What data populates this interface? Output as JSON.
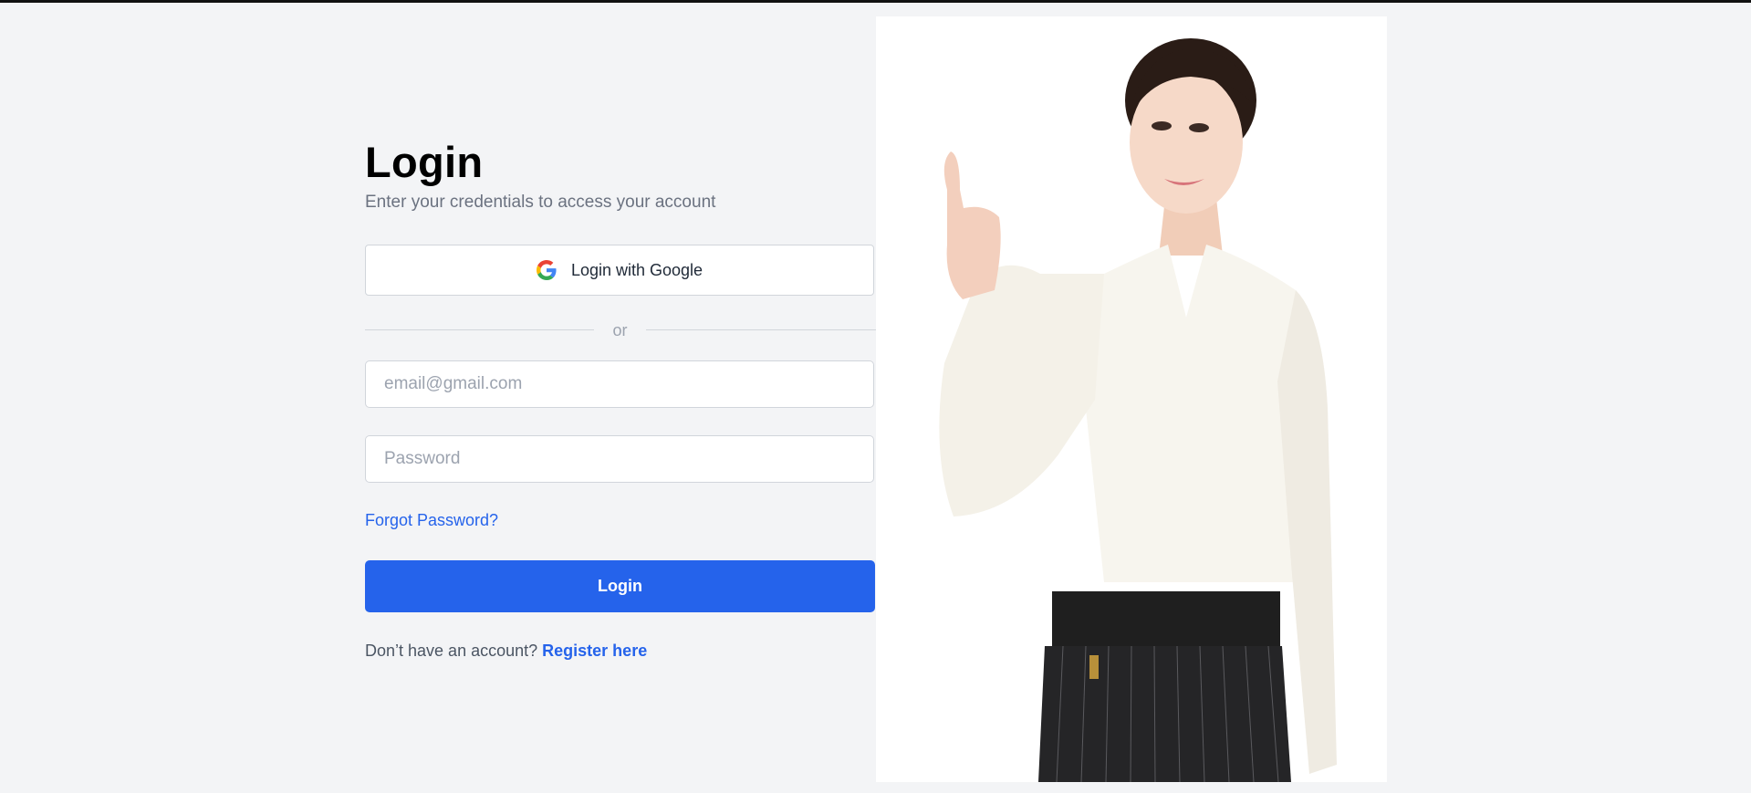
{
  "login": {
    "title": "Login",
    "subtitle": "Enter your credentials to access your account",
    "google_button_label": "Login with Google",
    "divider_text": "or",
    "email_placeholder": "email@gmail.com",
    "password_placeholder": "Password",
    "forgot_password_label": "Forgot Password?",
    "login_button_label": "Login",
    "register_prompt": "Don’t have an account?",
    "register_link_label": "Register here"
  },
  "icons": {
    "google": "google-icon"
  },
  "colors": {
    "accent": "#2563eb",
    "background": "#f3f4f6",
    "muted_text": "#6b7280",
    "border": "#d1d5db"
  }
}
